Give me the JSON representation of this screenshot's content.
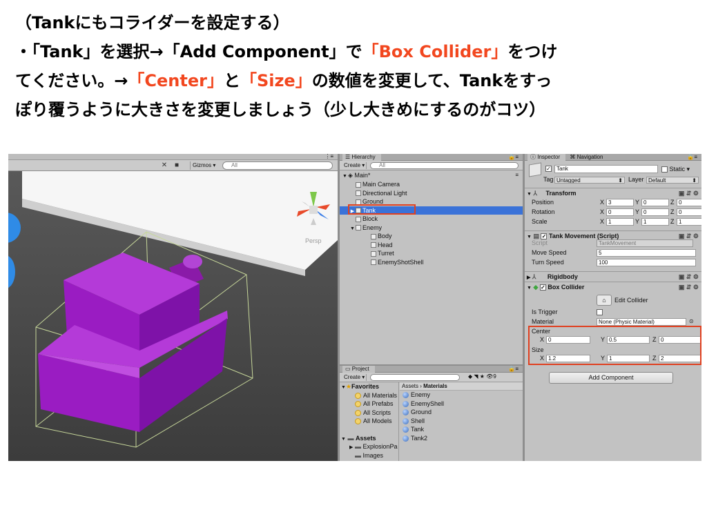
{
  "instructions": {
    "line1": "（Tankにもコライダーを設定する）",
    "line2_a": "・「Tank」を選択→「Add Component」で",
    "line2_b": "「Box Collider」",
    "line2_c": "をつけ",
    "line3_a": "てください。→",
    "line3_b": "「Center」",
    "line3_c": "と",
    "line3_d": "「Size」",
    "line3_e": "の数値を変更して、Tankをすっ",
    "line4": "ぽり覆うように大きさを変更しましょう（少し大きめにするのがコツ）",
    "accent_color": "#f2471f"
  },
  "scene": {
    "gizmos_label": "Gizmos",
    "search_placeholder": "All",
    "persp_label": "Persp",
    "tank_color": "#a020c8",
    "icons": [
      "tools-icon",
      "camera-icon"
    ]
  },
  "hierarchy": {
    "tab_label": "Hierarchy",
    "create_label": "Create",
    "search_placeholder": "All",
    "scene_name": "Main*",
    "items": [
      {
        "label": "Main Camera",
        "indent": 1
      },
      {
        "label": "Directional Light",
        "indent": 1
      },
      {
        "label": "Ground",
        "indent": 1
      },
      {
        "label": "Tank",
        "indent": 1,
        "selected": true,
        "expandable": true
      },
      {
        "label": "Block",
        "indent": 1
      },
      {
        "label": "Enemy",
        "indent": 1,
        "expanded": true
      },
      {
        "label": "Body",
        "indent": 2
      },
      {
        "label": "Head",
        "indent": 2
      },
      {
        "label": "Turret",
        "indent": 2
      },
      {
        "label": "EnemyShotShell",
        "indent": 2
      }
    ]
  },
  "project": {
    "tab_label": "Project",
    "create_label": "Create",
    "favorites_label": "Favorites",
    "favorites": [
      "All Materials",
      "All Prefabs",
      "All Scripts",
      "All Models"
    ],
    "assets_label": "Assets",
    "asset_folders": [
      "ExplosionPa",
      "Images"
    ],
    "breadcrumb_root": "Assets",
    "breadcrumb_current": "Materials",
    "materials": [
      "Enemy",
      "EnemyShell",
      "Ground",
      "Shell",
      "Tank",
      "Tank2"
    ],
    "count_label": "9"
  },
  "inspector": {
    "tab_label": "Inspector",
    "nav_tab_label": "Navigation",
    "object_name": "Tank",
    "static_label": "Static",
    "tag_label": "Tag",
    "tag_value": "Untagged",
    "layer_label": "Layer",
    "layer_value": "Default",
    "transform": {
      "title": "Transform",
      "position_label": "Position",
      "rotation_label": "Rotation",
      "scale_label": "Scale",
      "position": {
        "x": "3",
        "y": "0",
        "z": "0"
      },
      "rotation": {
        "x": "0",
        "y": "0",
        "z": "0"
      },
      "scale": {
        "x": "1",
        "y": "1",
        "z": "1"
      }
    },
    "tank_movement": {
      "title": "Tank Movement (Script)",
      "script_label": "Script",
      "script_value": "TankMovement",
      "move_speed_label": "Move Speed",
      "move_speed": "5",
      "turn_speed_label": "Turn Speed",
      "turn_speed": "100"
    },
    "rigidbody": {
      "title": "Rigidbody"
    },
    "box_collider": {
      "title": "Box Collider",
      "edit_collider_label": "Edit Collider",
      "is_trigger_label": "Is Trigger",
      "material_label": "Material",
      "material_value": "None (Physic Material)",
      "center_label": "Center",
      "size_label": "Size",
      "center": {
        "x": "0",
        "y": "0.5",
        "z": "0"
      },
      "size": {
        "x": "1.2",
        "y": "1",
        "z": "2"
      }
    },
    "add_component_label": "Add Component",
    "axis": {
      "x": "X",
      "y": "Y",
      "z": "Z"
    }
  }
}
